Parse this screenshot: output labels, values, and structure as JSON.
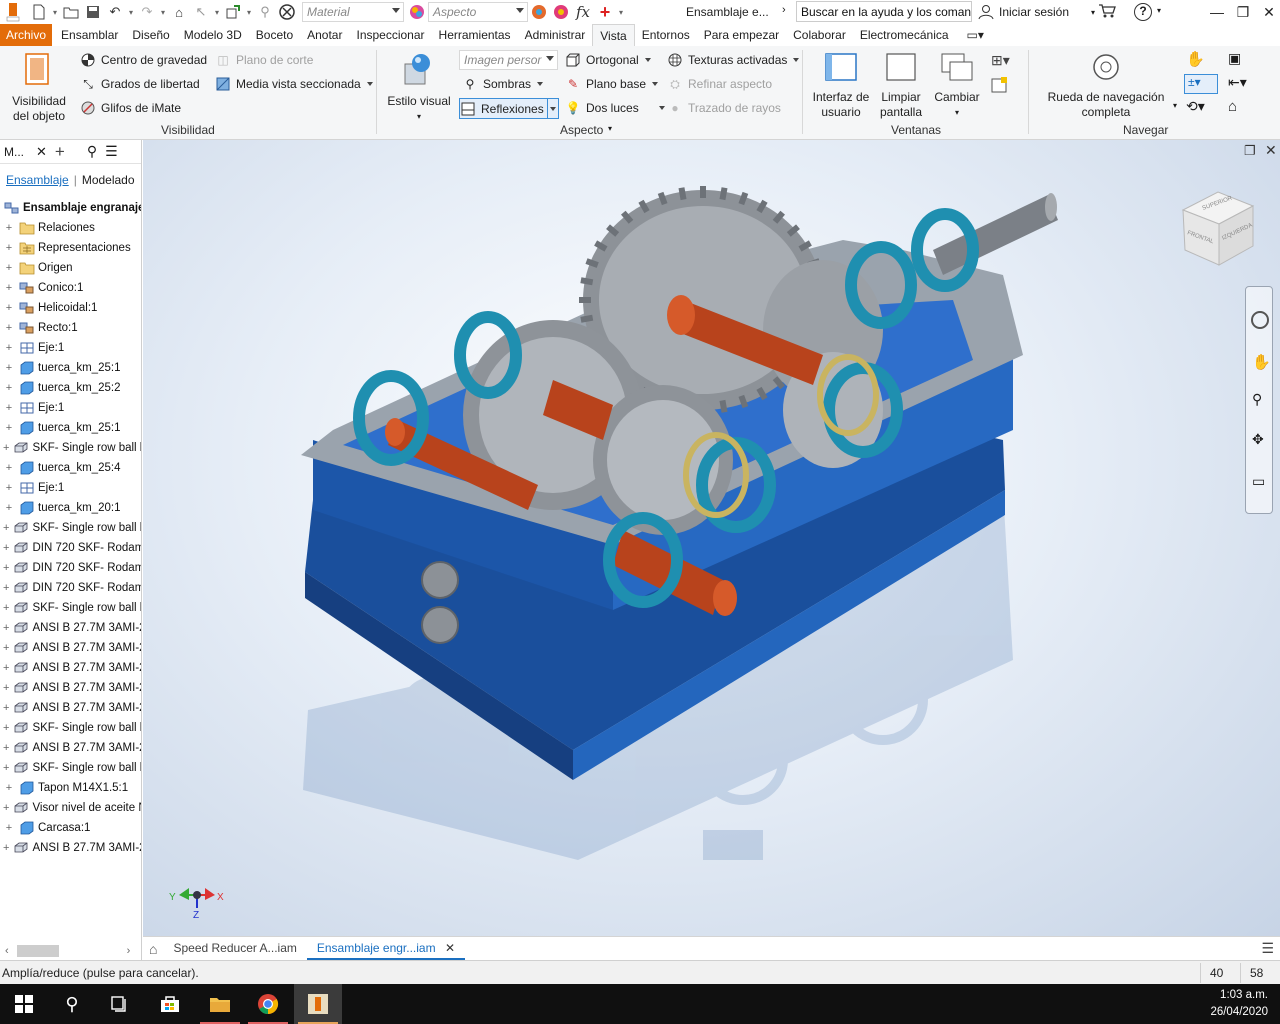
{
  "titlebar": {
    "material_placeholder": "Material",
    "appearance_placeholder": "Aspecto",
    "fx_label": "fx",
    "doc_title": "Ensamblaje e...",
    "search_text": "Buscar en la ayuda y los comandos",
    "signin_label": "Iniciar sesión",
    "help_label": "?"
  },
  "ribbon_tabs": [
    "Archivo",
    "Ensamblar",
    "Diseño",
    "Modelo 3D",
    "Boceto",
    "Anotar",
    "Inspeccionar",
    "Herramientas",
    "Administrar",
    "Vista",
    "Entornos",
    "Para empezar",
    "Colaborar",
    "Electromecánica"
  ],
  "ribbon": {
    "visibilidad": {
      "title": "Visibilidad",
      "obj_vis": "Visibilidad del objeto",
      "cog": "Centro de gravedad",
      "dof": "Grados de libertad",
      "imate": "Glifos de iMate",
      "section_plane": "Plano de corte",
      "half_section": "Media vista seccionada"
    },
    "aspecto": {
      "title": "Aspecto",
      "visual_style": "Estilo visual",
      "image_combo": "Imagen persor",
      "shadows": "Sombras",
      "reflections": "Reflexiones",
      "ortho": "Ortogonal",
      "ground_plane": "Plano base",
      "two_lights": "Dos luces",
      "textures": "Texturas activadas",
      "refine": "Refinar aspecto",
      "raytrace": "Trazado de rayos"
    },
    "ventanas": {
      "title": "Ventanas",
      "ui": "Interfaz de usuario",
      "clean": "Limpiar pantalla",
      "switch": "Cambiar"
    },
    "navegar": {
      "title": "Navegar",
      "wheel": "Rueda de navegación completa"
    }
  },
  "browser": {
    "title": "M...",
    "tab_assembly": "Ensamblaje",
    "tab_modeling": "Modelado",
    "root": "Ensamblaje engranaje",
    "items": [
      {
        "label": "Relaciones",
        "icon": "folder"
      },
      {
        "label": "Representaciones",
        "icon": "folder-table"
      },
      {
        "label": "Origen",
        "icon": "folder"
      },
      {
        "label": "Conico:1",
        "icon": "subassembly"
      },
      {
        "label": "Helicoidal:1",
        "icon": "subassembly"
      },
      {
        "label": "Recto:1",
        "icon": "subassembly"
      },
      {
        "label": "Eje:1",
        "icon": "frame"
      },
      {
        "label": "tuerca_km_25:1",
        "icon": "part"
      },
      {
        "label": "tuerca_km_25:2",
        "icon": "part"
      },
      {
        "label": "Eje:1",
        "icon": "frame"
      },
      {
        "label": "tuerca_km_25:1",
        "icon": "part"
      },
      {
        "label": "SKF- Single row ball b",
        "icon": "bearing"
      },
      {
        "label": "tuerca_km_25:4",
        "icon": "part"
      },
      {
        "label": "Eje:1",
        "icon": "frame"
      },
      {
        "label": "tuerca_km_20:1",
        "icon": "part"
      },
      {
        "label": "SKF- Single row ball b",
        "icon": "bearing"
      },
      {
        "label": "DIN 720 SKF- Rodami",
        "icon": "bearing"
      },
      {
        "label": "DIN 720 SKF- Rodami",
        "icon": "bearing"
      },
      {
        "label": "DIN 720 SKF- Rodami",
        "icon": "bearing"
      },
      {
        "label": "SKF- Single row ball b",
        "icon": "bearing"
      },
      {
        "label": "ANSI B 27.7M 3AMI-2",
        "icon": "bearing"
      },
      {
        "label": "ANSI B 27.7M 3AMI-2",
        "icon": "bearing"
      },
      {
        "label": "ANSI B 27.7M 3AMI-2",
        "icon": "bearing"
      },
      {
        "label": "ANSI B 27.7M 3AMI-2",
        "icon": "bearing"
      },
      {
        "label": "ANSI B 27.7M 3AMI-2",
        "icon": "bearing"
      },
      {
        "label": "SKF- Single row ball b",
        "icon": "bearing"
      },
      {
        "label": "ANSI B 27.7M 3AMI-2",
        "icon": "bearing"
      },
      {
        "label": "SKF- Single row ball b",
        "icon": "bearing"
      },
      {
        "label": "Tapon M14X1.5:1",
        "icon": "part"
      },
      {
        "label": "Visor nivel de aceite N",
        "icon": "bearing"
      },
      {
        "label": "Carcasa:1",
        "icon": "part"
      },
      {
        "label": "ANSI B 27.7M 3AMI-2",
        "icon": "bearing"
      }
    ]
  },
  "viewcube": {
    "face_front": "FRONTAL",
    "face_left": "IZQUIERDA",
    "face_top": "SUPERIOR"
  },
  "triad": {
    "x": "X",
    "y": "Y",
    "z": "Z"
  },
  "document_tabs": [
    "Speed Reducer A...iam",
    "Ensamblaje engr...iam"
  ],
  "status": {
    "message": "Amplía/reduce (pulse para cancelar).",
    "count_a": "40",
    "count_b": "58"
  },
  "clock": {
    "time": "1:03 a.m.",
    "date": "26/04/2020"
  },
  "colors": {
    "accent_orange": "#e36c09",
    "accent_blue": "#1a6fc0",
    "housing_blue": "#1f5fb5",
    "bearing_teal": "#1f8fb0",
    "shaft_copper": "#b8431c"
  }
}
